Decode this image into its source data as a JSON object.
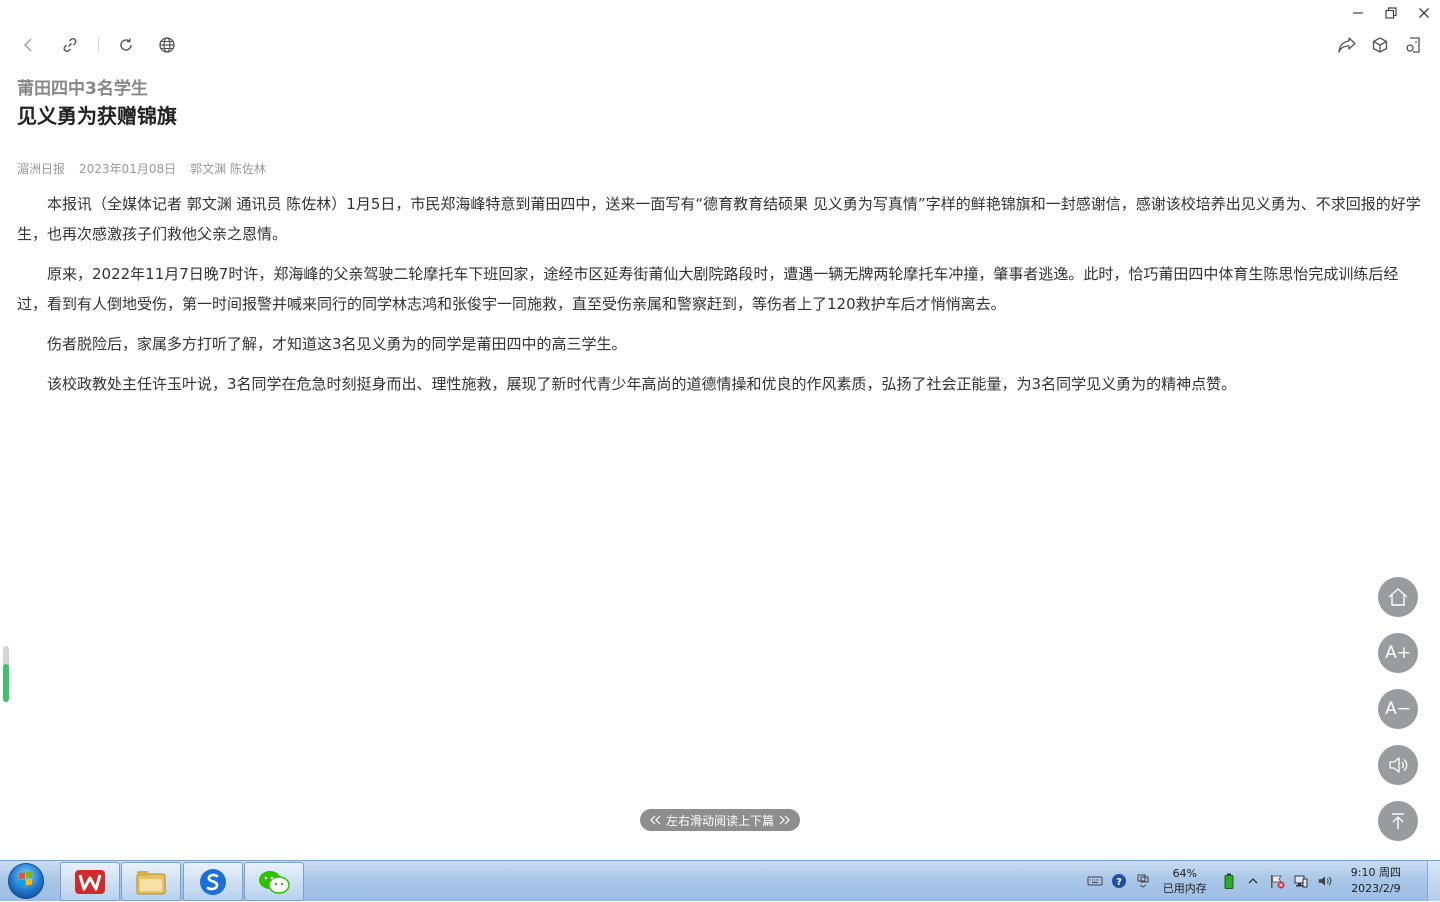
{
  "window": {
    "minimize_label": "−",
    "restore_label": "❐",
    "close_label": "✕"
  },
  "article": {
    "subtitle": "莆田四中3名学生",
    "title": "见义勇为获赠锦旗",
    "source": "湄洲日报",
    "date": "2023年01月08日",
    "authors": "郭文渊 陈佐林",
    "paragraphs": [
      "本报讯（全媒体记者 郭文渊 通讯员 陈佐林）1月5日，市民郑海峰特意到莆田四中，送来一面写有“德育教育结硕果 见义勇为写真情”字样的鲜艳锦旗和一封感谢信，感谢该校培养出见义勇为、不求回报的好学生，也再次感激孩子们救他父亲之恩情。",
      "原来，2022年11月7日晚7时许，郑海峰的父亲驾驶二轮摩托车下班回家，途经市区延寿街莆仙大剧院路段时，遭遇一辆无牌两轮摩托车冲撞，肇事者逃逸。此时，恰巧莆田四中体育生陈思怡完成训练后经过，看到有人倒地受伤，第一时间报警并喊来同行的同学林志鸿和张俊宇一同施救，直至受伤亲属和警察赶到，等伤者上了120救护车后才悄悄离去。",
      "伤者脱险后，家属多方打听了解，才知道这3名见义勇为的同学是莆田四中的高三学生。",
      "该校政教处主任许玉叶说，3名同学在危急时刻挺身而出、理性施救，展现了新时代青少年高尚的道德情操和优良的作风素质，弘扬了社会正能量，为3名同学见义勇为的精神点赞。"
    ]
  },
  "float_buttons": {
    "font_increase": "A+",
    "font_decrease": "A−"
  },
  "swipe_hint": "左右滑动阅读上下篇",
  "reading_progress": 0.68,
  "taskbar": {
    "memory_percent": "64%",
    "memory_label": "已用内存",
    "time": "9:10 周四",
    "date": "2023/2/9"
  },
  "colors": {
    "accent_green": "#3cc36b",
    "float_button": "#999b9e",
    "wps_red": "#d22b2b",
    "wechat_green": "#2dc100"
  }
}
